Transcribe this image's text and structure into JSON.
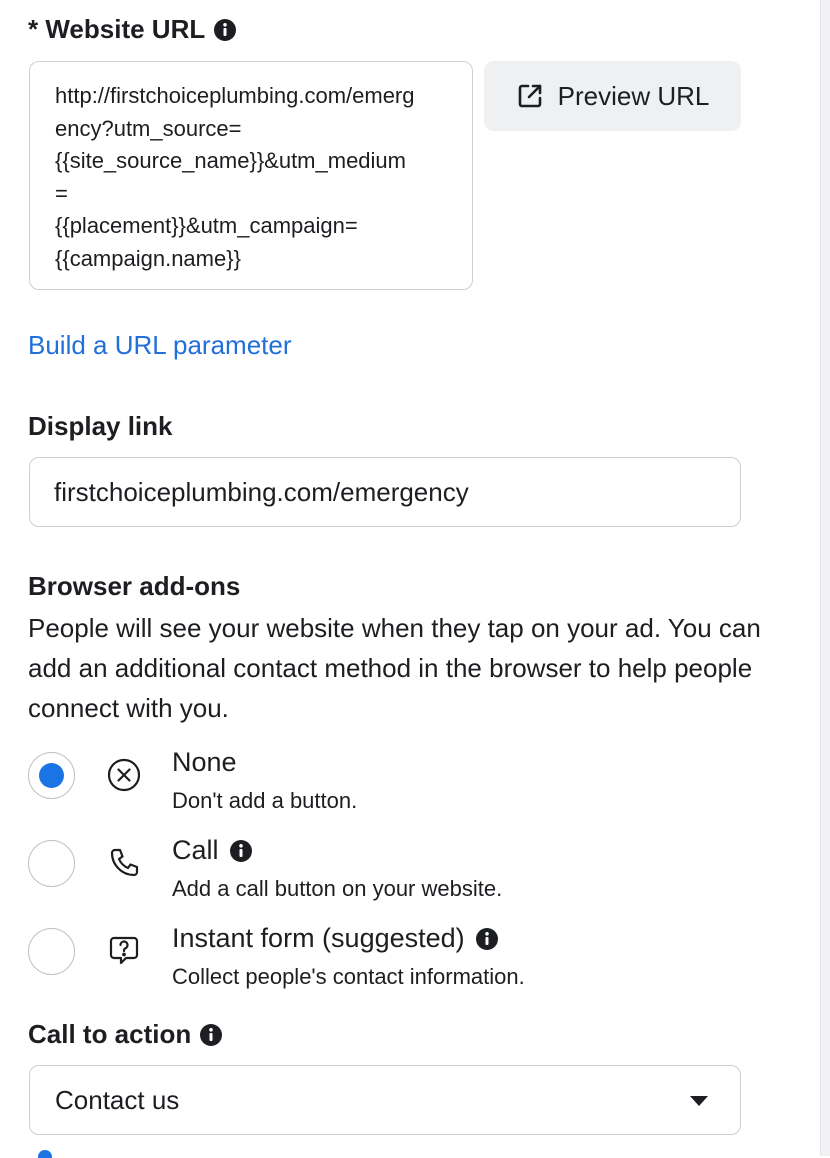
{
  "website_url": {
    "required_mark": "*",
    "label": "Website URL",
    "value": "http://firstchoiceplumbing.com/emergency?utm_source=\n{{site_source_name}}&utm_medium=\n{{placement}}&utm_campaign=\n{{campaign.name}}",
    "preview_button": "Preview URL",
    "build_link": "Build a URL parameter"
  },
  "display_link": {
    "label": "Display link",
    "value": "firstchoiceplumbing.com/emergency"
  },
  "browser_addons": {
    "label": "Browser add-ons",
    "description": "People will see your website when they tap on your ad. You can add an additional contact method in the browser to help people connect with you.",
    "options": [
      {
        "title": "None",
        "subtitle": "Don't add a button.",
        "icon": "circle-x-icon",
        "selected": true
      },
      {
        "title": "Call",
        "subtitle": "Add a call button on your website.",
        "icon": "phone-icon",
        "selected": false
      },
      {
        "title": "Instant form (suggested)",
        "subtitle": "Collect people's contact information.",
        "icon": "question-bubble-icon",
        "selected": false
      }
    ]
  },
  "call_to_action": {
    "label": "Call to action",
    "value": "Contact us"
  },
  "colors": {
    "accent": "#1b74e4",
    "link": "#216fdb",
    "border": "#ccd0d5"
  }
}
